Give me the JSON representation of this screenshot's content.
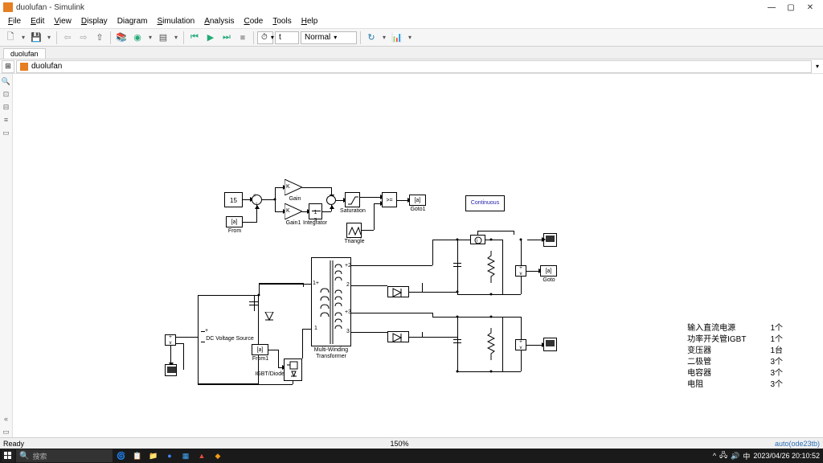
{
  "window": {
    "title": "duolufan - Simulink",
    "min_label": "—",
    "max_label": "▢",
    "close_label": "✕"
  },
  "menu": {
    "items": [
      "File",
      "Edit",
      "View",
      "Display",
      "Diagram",
      "Simulation",
      "Analysis",
      "Code",
      "Tools",
      "Help"
    ]
  },
  "toolbar": {
    "stop_time": "t",
    "mode": "Normal"
  },
  "tab": {
    "name": "duolufan"
  },
  "breadcrumb": {
    "text": "duolufan"
  },
  "status": {
    "left": "Ready",
    "center": "150%",
    "right": "auto(ode23tb)"
  },
  "taskbar": {
    "search_placeholder": "搜索",
    "datetime": "2023/04/26 20:10:52"
  },
  "blocks": {
    "const15": "15",
    "gain": "Gain",
    "gain1": "Gain1",
    "integrator_sym": "1/s",
    "integrator": "Integrator",
    "saturation": "Saturation",
    "goto1": "Goto1",
    "goto1_tag": "[a]",
    "from_tag": "[a]",
    "from": "From",
    "triangle": "Triangle",
    "continuous": "Continuous",
    "dc_source": "DC Voltage Source",
    "from1_tag": "[a]",
    "from1": "From1",
    "igbt": "IGBT/Diode",
    "xformer1": "Multi-Winding",
    "xformer2": "Transformer",
    "goto_tag": "[a]",
    "goto": "Goto",
    "relop": ">="
  },
  "ports": {
    "t1_1p": "1+",
    "t1_1": "1",
    "t1_2p": "+2",
    "t1_2": "2",
    "t1_3p": "+3",
    "t1_3": "3"
  },
  "components": {
    "rows": [
      {
        "name": "输入直流电源",
        "qty": "1个"
      },
      {
        "name": "功率开关管IGBT",
        "qty": "1个"
      },
      {
        "name": "变压器",
        "qty": "1台"
      },
      {
        "name": "二极管",
        "qty": "3个"
      },
      {
        "name": "电容器",
        "qty": "3个"
      },
      {
        "name": "电阻",
        "qty": "3个"
      }
    ]
  }
}
